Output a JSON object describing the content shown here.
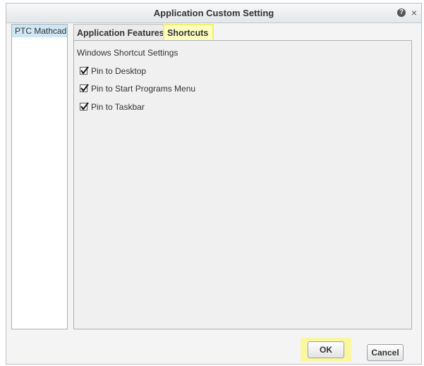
{
  "window": {
    "title": "Application Custom Setting",
    "help_glyph": "?",
    "close_glyph": "×"
  },
  "sidebar": {
    "items": [
      {
        "label": "PTC Mathcad",
        "selected": true
      }
    ]
  },
  "tabs": [
    {
      "label": "Application Features",
      "active": false
    },
    {
      "label": "Shortcuts",
      "active": true
    }
  ],
  "panel": {
    "heading": "Windows Shortcut Settings",
    "options": [
      {
        "label": "Pin to Desktop",
        "checked": true
      },
      {
        "label": "Pin to Start Programs Menu",
        "checked": true
      },
      {
        "label": "Pin to Taskbar",
        "checked": true
      }
    ]
  },
  "footer": {
    "ok_label": "OK",
    "cancel_label": "Cancel"
  },
  "colors": {
    "highlight": "#fefec0",
    "selection": "#cfe6f5"
  }
}
